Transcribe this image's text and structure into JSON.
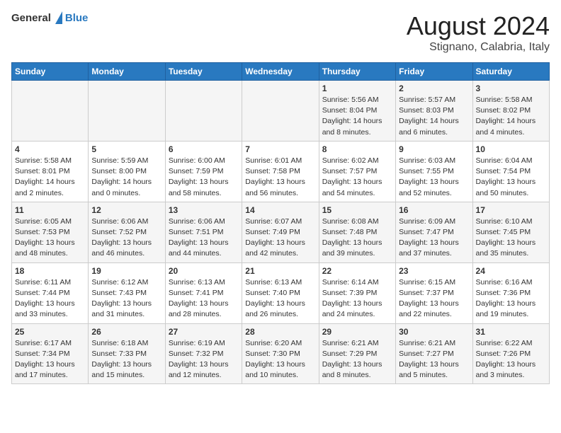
{
  "header": {
    "logo": {
      "general": "General",
      "blue": "Blue"
    },
    "title": "August 2024",
    "location": "Stignano, Calabria, Italy"
  },
  "calendar": {
    "weekdays": [
      "Sunday",
      "Monday",
      "Tuesday",
      "Wednesday",
      "Thursday",
      "Friday",
      "Saturday"
    ],
    "weeks": [
      [
        {
          "day": "",
          "info": ""
        },
        {
          "day": "",
          "info": ""
        },
        {
          "day": "",
          "info": ""
        },
        {
          "day": "",
          "info": ""
        },
        {
          "day": "1",
          "info": "Sunrise: 5:56 AM\nSunset: 8:04 PM\nDaylight: 14 hours\nand 8 minutes."
        },
        {
          "day": "2",
          "info": "Sunrise: 5:57 AM\nSunset: 8:03 PM\nDaylight: 14 hours\nand 6 minutes."
        },
        {
          "day": "3",
          "info": "Sunrise: 5:58 AM\nSunset: 8:02 PM\nDaylight: 14 hours\nand 4 minutes."
        }
      ],
      [
        {
          "day": "4",
          "info": "Sunrise: 5:58 AM\nSunset: 8:01 PM\nDaylight: 14 hours\nand 2 minutes."
        },
        {
          "day": "5",
          "info": "Sunrise: 5:59 AM\nSunset: 8:00 PM\nDaylight: 14 hours\nand 0 minutes."
        },
        {
          "day": "6",
          "info": "Sunrise: 6:00 AM\nSunset: 7:59 PM\nDaylight: 13 hours\nand 58 minutes."
        },
        {
          "day": "7",
          "info": "Sunrise: 6:01 AM\nSunset: 7:58 PM\nDaylight: 13 hours\nand 56 minutes."
        },
        {
          "day": "8",
          "info": "Sunrise: 6:02 AM\nSunset: 7:57 PM\nDaylight: 13 hours\nand 54 minutes."
        },
        {
          "day": "9",
          "info": "Sunrise: 6:03 AM\nSunset: 7:55 PM\nDaylight: 13 hours\nand 52 minutes."
        },
        {
          "day": "10",
          "info": "Sunrise: 6:04 AM\nSunset: 7:54 PM\nDaylight: 13 hours\nand 50 minutes."
        }
      ],
      [
        {
          "day": "11",
          "info": "Sunrise: 6:05 AM\nSunset: 7:53 PM\nDaylight: 13 hours\nand 48 minutes."
        },
        {
          "day": "12",
          "info": "Sunrise: 6:06 AM\nSunset: 7:52 PM\nDaylight: 13 hours\nand 46 minutes."
        },
        {
          "day": "13",
          "info": "Sunrise: 6:06 AM\nSunset: 7:51 PM\nDaylight: 13 hours\nand 44 minutes."
        },
        {
          "day": "14",
          "info": "Sunrise: 6:07 AM\nSunset: 7:49 PM\nDaylight: 13 hours\nand 42 minutes."
        },
        {
          "day": "15",
          "info": "Sunrise: 6:08 AM\nSunset: 7:48 PM\nDaylight: 13 hours\nand 39 minutes."
        },
        {
          "day": "16",
          "info": "Sunrise: 6:09 AM\nSunset: 7:47 PM\nDaylight: 13 hours\nand 37 minutes."
        },
        {
          "day": "17",
          "info": "Sunrise: 6:10 AM\nSunset: 7:45 PM\nDaylight: 13 hours\nand 35 minutes."
        }
      ],
      [
        {
          "day": "18",
          "info": "Sunrise: 6:11 AM\nSunset: 7:44 PM\nDaylight: 13 hours\nand 33 minutes."
        },
        {
          "day": "19",
          "info": "Sunrise: 6:12 AM\nSunset: 7:43 PM\nDaylight: 13 hours\nand 31 minutes."
        },
        {
          "day": "20",
          "info": "Sunrise: 6:13 AM\nSunset: 7:41 PM\nDaylight: 13 hours\nand 28 minutes."
        },
        {
          "day": "21",
          "info": "Sunrise: 6:13 AM\nSunset: 7:40 PM\nDaylight: 13 hours\nand 26 minutes."
        },
        {
          "day": "22",
          "info": "Sunrise: 6:14 AM\nSunset: 7:39 PM\nDaylight: 13 hours\nand 24 minutes."
        },
        {
          "day": "23",
          "info": "Sunrise: 6:15 AM\nSunset: 7:37 PM\nDaylight: 13 hours\nand 22 minutes."
        },
        {
          "day": "24",
          "info": "Sunrise: 6:16 AM\nSunset: 7:36 PM\nDaylight: 13 hours\nand 19 minutes."
        }
      ],
      [
        {
          "day": "25",
          "info": "Sunrise: 6:17 AM\nSunset: 7:34 PM\nDaylight: 13 hours\nand 17 minutes."
        },
        {
          "day": "26",
          "info": "Sunrise: 6:18 AM\nSunset: 7:33 PM\nDaylight: 13 hours\nand 15 minutes."
        },
        {
          "day": "27",
          "info": "Sunrise: 6:19 AM\nSunset: 7:32 PM\nDaylight: 13 hours\nand 12 minutes."
        },
        {
          "day": "28",
          "info": "Sunrise: 6:20 AM\nSunset: 7:30 PM\nDaylight: 13 hours\nand 10 minutes."
        },
        {
          "day": "29",
          "info": "Sunrise: 6:21 AM\nSunset: 7:29 PM\nDaylight: 13 hours\nand 8 minutes."
        },
        {
          "day": "30",
          "info": "Sunrise: 6:21 AM\nSunset: 7:27 PM\nDaylight: 13 hours\nand 5 minutes."
        },
        {
          "day": "31",
          "info": "Sunrise: 6:22 AM\nSunset: 7:26 PM\nDaylight: 13 hours\nand 3 minutes."
        }
      ]
    ]
  }
}
